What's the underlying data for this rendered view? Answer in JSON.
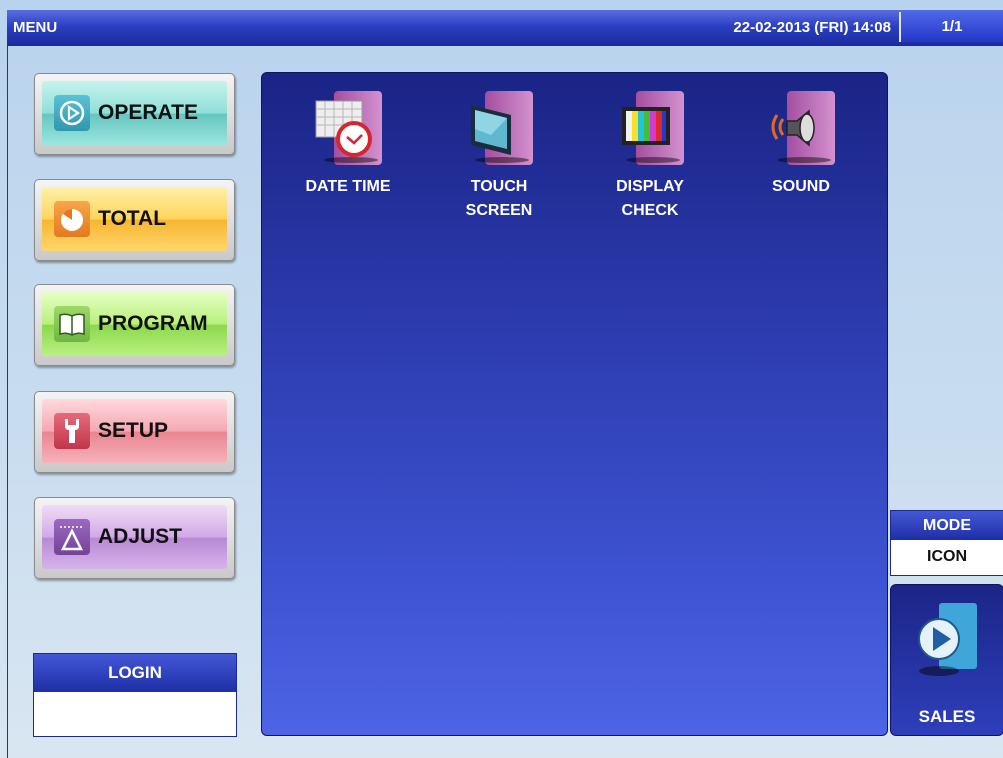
{
  "header": {
    "title": "MENU",
    "datetime": "22-02-2013 (FRI)  14:08",
    "page": "1/1"
  },
  "sidebar": {
    "items": [
      {
        "label": "OPERATE",
        "icon": "play-circle-icon"
      },
      {
        "label": "TOTAL",
        "icon": "pie-chart-icon"
      },
      {
        "label": "PROGRAM",
        "icon": "book-icon"
      },
      {
        "label": "SETUP",
        "icon": "wrench-icon"
      },
      {
        "label": "ADJUST",
        "icon": "scale-weight-icon"
      }
    ]
  },
  "login": {
    "label": "LOGIN",
    "value": ""
  },
  "menu_items": [
    {
      "label_line1": "DATE TIME",
      "label_line2": "",
      "icon": "calendar-clock-icon"
    },
    {
      "label_line1": "TOUCH",
      "label_line2": "SCREEN",
      "icon": "touch-screen-icon"
    },
    {
      "label_line1": "DISPLAY",
      "label_line2": "CHECK",
      "icon": "display-check-icon"
    },
    {
      "label_line1": "SOUND",
      "label_line2": "",
      "icon": "speaker-icon"
    }
  ],
  "mode": {
    "label": "MODE",
    "value": "ICON"
  },
  "sales": {
    "label": "SALES",
    "icon": "play-arrow-icon"
  },
  "colors": {
    "header_blue": "#2b3fc2",
    "panel_blue": "#2d3cb0",
    "operate": "#8fdfd8",
    "total": "#ffd45c",
    "program": "#b7f07a",
    "setup": "#f5a8b2",
    "adjust": "#d1a9e6"
  }
}
